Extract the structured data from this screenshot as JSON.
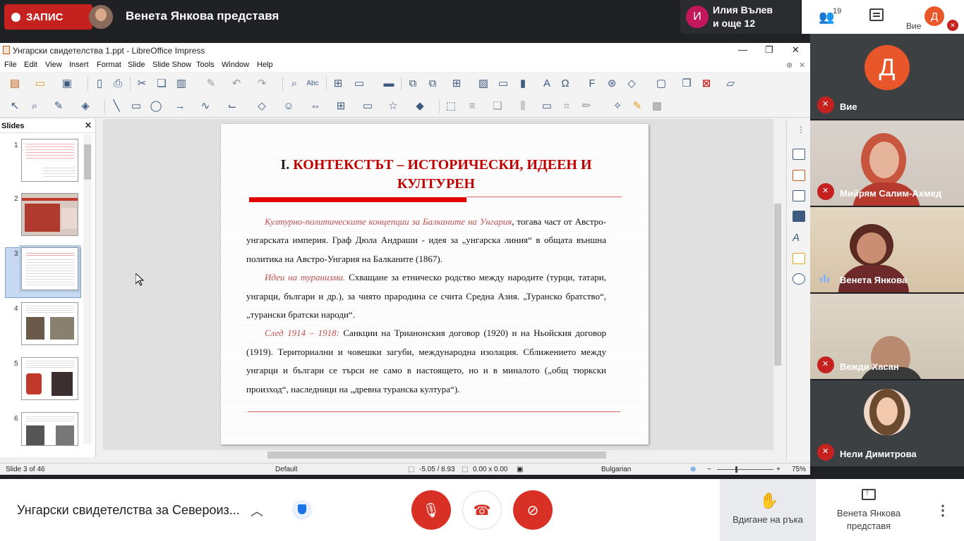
{
  "meet": {
    "record_label": "ЗАПИС",
    "presenting_title": "Венета Янкова представя",
    "other_participant_initial": "И",
    "other_participant_line1": "Илия Вълев",
    "other_participant_line2": "и още 12",
    "people_count": "19",
    "self_initial": "Д",
    "self_label": "Вие",
    "meeting_title": "Унгарски свидетелства за Североиз...",
    "raise_hand_label": "Вдигане на ръка",
    "presenter_label_1": "Венета Янкова",
    "presenter_label_2": "представя"
  },
  "participants": [
    {
      "name": "Вие",
      "initial": "Д",
      "muted": true
    },
    {
      "name": "Мийрям Салим-Ахмед",
      "muted": true
    },
    {
      "name": "Венета Янкова",
      "muted": false,
      "speaking": true
    },
    {
      "name": "Вежди Хасан",
      "muted": true
    },
    {
      "name": "Нели Димитрова",
      "muted": true
    }
  ],
  "libreoffice": {
    "window_title": "Унгарски свидетелства 1.ppt - LibreOffice Impress",
    "menu": [
      "File",
      "Edit",
      "View",
      "Insert",
      "Format",
      "Slide",
      "Slide Show",
      "Tools",
      "Window",
      "Help"
    ],
    "slides_pane_title": "Slides",
    "slide_numbers": [
      "1",
      "2",
      "3",
      "4",
      "5",
      "6"
    ],
    "status": {
      "slide": "Slide 3 of 46",
      "layout": "Default",
      "position": "-5.05 / 8.93",
      "size": "0.00 x 0.00",
      "language": "Bulgarian",
      "zoom": "75%"
    }
  },
  "slide": {
    "title_num": "I. ",
    "title_line1": "КОНТЕКСТЪТ – ИСТОРИЧЕСКИ, ИДЕЕН И",
    "title_line2": "КУЛТУРЕН",
    "p1_hl": "Културно-политическите концепции за Балканите на Унгария",
    "p1_text": ", тогава част от Австро-унгарската империя. Граф Дюла Андраши - идея за „унгарска линия“ в общата външна политика на Австро-Унгария на Балканите (1867).",
    "p2_hl": "Идеи на туранизма.",
    "p2_text": "  Схващане за етническо родство между народите (турци, татари, унгарци, българи и др.), за чиято прародина се счита Средна Азия. „Туранско братство“, „турански братски народи“.",
    "p3_hl": "След 1914 – 1918:",
    "p3_text": " Санкции на Трианонския договор (1920) и на Ньойския договор (1919). Териториални и човешки загуби, международна изолация. Сближението между унгарци и българи се търси не само в настоящето, но и в миналото („общ тюркски произход“, наследници на „древна туранска култура“)."
  }
}
